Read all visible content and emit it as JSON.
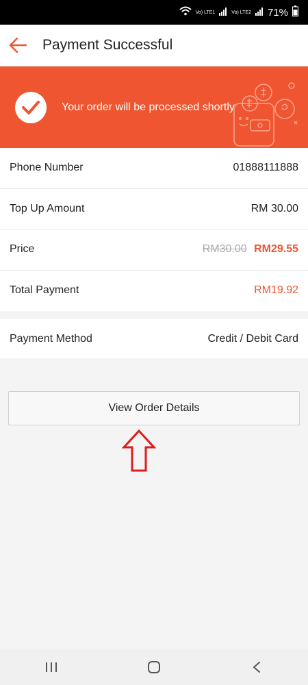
{
  "status_bar": {
    "battery": "71%",
    "lte1": "Vo) LTE1",
    "lte2": "Vo) LTE2"
  },
  "header": {
    "title": "Payment Successful"
  },
  "banner": {
    "message": "Your order will be processed shortly"
  },
  "details": {
    "phone_label": "Phone Number",
    "phone_value": "01888111888",
    "topup_label": "Top Up Amount",
    "topup_value": "RM 30.00",
    "price_label": "Price",
    "price_original": "RM30.00",
    "price_discounted": "RM29.55",
    "total_label": "Total Payment",
    "total_value": "RM19.92"
  },
  "payment": {
    "label": "Payment Method",
    "value": "Credit / Debit Card"
  },
  "actions": {
    "view_order": "View Order Details"
  },
  "colors": {
    "accent": "#ee5530",
    "annotation": "#e01b1b"
  },
  "icons": [
    "back-arrow-icon",
    "check-icon",
    "up-arrow-annotation",
    "recents-icon",
    "home-icon",
    "back-icon"
  ]
}
